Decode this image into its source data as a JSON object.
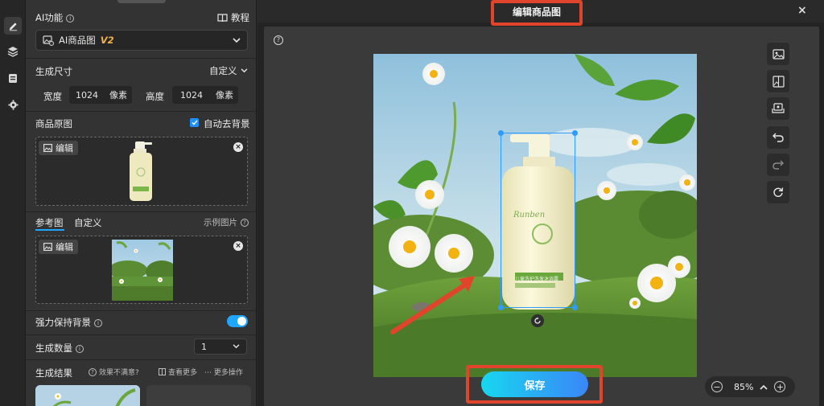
{
  "panel": {
    "ai_function_label": "AI功能",
    "tutorial_label": "教程",
    "mode_select": {
      "label": "AI商品图",
      "version": "V2"
    },
    "size_label": "生成尺寸",
    "size_mode": "自定义",
    "width_label": "宽度",
    "width_value": "1024",
    "width_unit": "像素",
    "height_label": "高度",
    "height_value": "1024",
    "height_unit": "像素",
    "product_image_label": "商品原图",
    "auto_remove_bg_label": "自动去背景",
    "auto_remove_bg_checked": true,
    "edit_label": "编辑",
    "ref_tabs": [
      "参考图",
      "自定义"
    ],
    "example_label": "示例图片",
    "keep_bg_label": "强力保持背景",
    "keep_bg_on": true,
    "count_label": "生成数量",
    "count_value": "1",
    "results_label": "生成结果",
    "unsatisfied_label": "效果不满意?",
    "view_more_label": "查看更多",
    "more_actions_label": "更多操作"
  },
  "main": {
    "title": "编辑商品图",
    "save_label": "保存",
    "zoom": "85%",
    "tools": [
      "image-icon",
      "replace-image-icon",
      "layers-icon",
      "undo-icon",
      "redo-icon",
      "reset-icon"
    ],
    "product_brand": "Runben",
    "product_tagline": "儿童洗护洗发沐浴露"
  },
  "colors": {
    "accent": "#1fa6ff",
    "highlight": "#e0442b",
    "save_gradient_start": "#17d7f0",
    "save_gradient_end": "#3b86f7"
  }
}
